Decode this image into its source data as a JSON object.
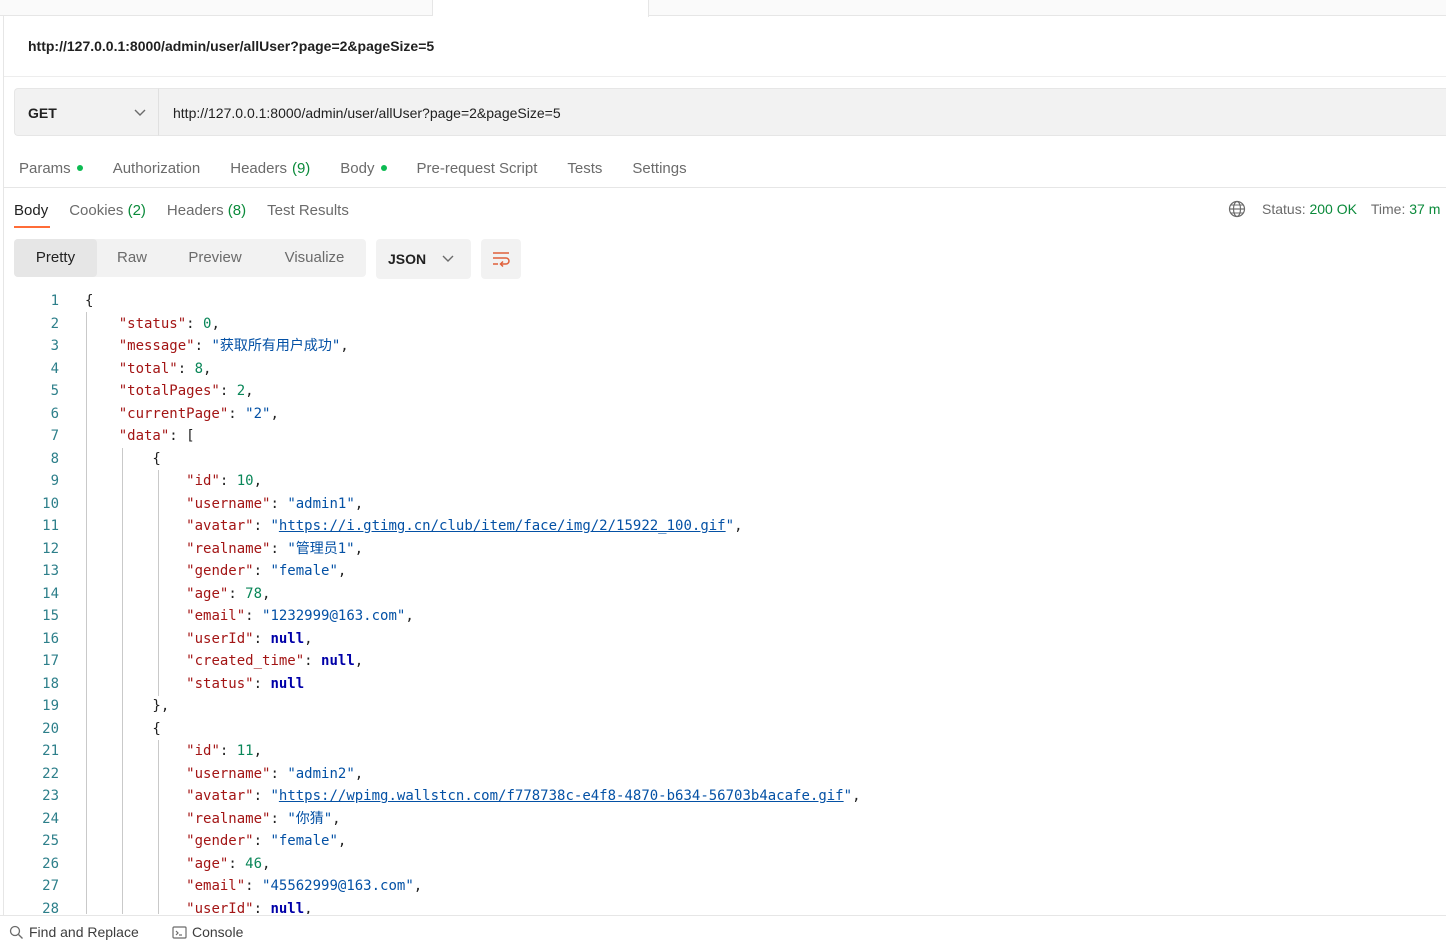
{
  "request": {
    "title": "http://127.0.0.1:8000/admin/user/allUser?page=2&pageSize=5",
    "method": "GET",
    "url": "http://127.0.0.1:8000/admin/user/allUser?page=2&pageSize=5"
  },
  "request_tabs": {
    "params": "Params",
    "authorization": "Authorization",
    "headers": "Headers",
    "headers_count": "(9)",
    "body": "Body",
    "prerequest": "Pre-request Script",
    "tests": "Tests",
    "settings": "Settings"
  },
  "response_tabs": {
    "body": "Body",
    "cookies": "Cookies",
    "cookies_count": "(2)",
    "headers": "Headers",
    "headers_count": "(8)",
    "test_results": "Test Results"
  },
  "response_status": {
    "status_label": "Status:",
    "status_value": "200 OK",
    "time_label": "Time:",
    "time_value": "37 m"
  },
  "view": {
    "pretty": "Pretty",
    "raw": "Raw",
    "preview": "Preview",
    "visualize": "Visualize",
    "format": "JSON"
  },
  "code_lines": [
    "{",
    "    \"status\": 0,",
    "    \"message\": \"获取所有用户成功\",",
    "    \"total\": 8,",
    "    \"totalPages\": 2,",
    "    \"currentPage\": \"2\",",
    "    \"data\": [",
    "        {",
    "            \"id\": 10,",
    "            \"username\": \"admin1\",",
    "            \"avatar\": \"https://i.gtimg.cn/club/item/face/img/2/15922_100.gif\",",
    "            \"realname\": \"管理员1\",",
    "            \"gender\": \"female\",",
    "            \"age\": 78,",
    "            \"email\": \"1232999@163.com\",",
    "            \"userId\": null,",
    "            \"created_time\": null,",
    "            \"status\": null",
    "        },",
    "        {",
    "            \"id\": 11,",
    "            \"username\": \"admin2\",",
    "            \"avatar\": \"https://wpimg.wallstcn.com/f778738c-e4f8-4870-b634-56703b4acafe.gif\",",
    "            \"realname\": \"你猜\",",
    "            \"gender\": \"female\",",
    "            \"age\": 46,",
    "            \"email\": \"45562999@163.com\",",
    "            \"userId\": null,"
  ],
  "footer": {
    "find_replace": "Find and Replace",
    "console": "Console"
  }
}
